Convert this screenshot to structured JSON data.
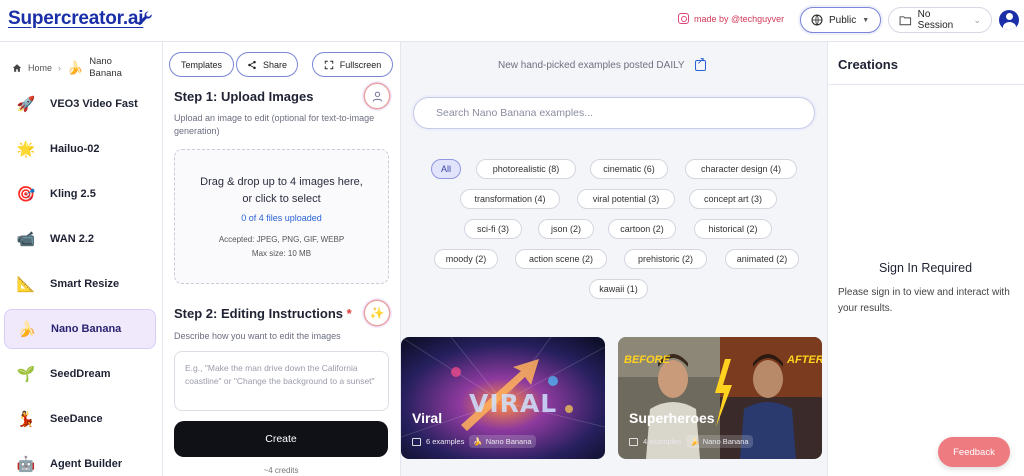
{
  "header": {
    "logo": "Supercreator.ai",
    "made_by": "made by @techguyver",
    "visibility": "Public",
    "session": "No Session"
  },
  "breadcrumb": {
    "home": "Home",
    "current": "Nano Banana"
  },
  "sidebar": {
    "items": [
      {
        "label": "VEO3 Video Fast",
        "icon": "rocket-icon",
        "glyph": "🚀"
      },
      {
        "label": "Hailuo-02",
        "icon": "sparkle-icon",
        "glyph": "🌟"
      },
      {
        "label": "Kling 2.5",
        "icon": "target-icon",
        "glyph": "🎯"
      },
      {
        "label": "WAN 2.2",
        "icon": "camera-icon",
        "glyph": "📹"
      },
      {
        "label": "Smart Resize",
        "icon": "ruler-icon",
        "glyph": "📐"
      },
      {
        "label": "Nano Banana",
        "icon": "banana-icon",
        "glyph": "🍌",
        "active": true
      },
      {
        "label": "SeedDream",
        "icon": "seedling-icon",
        "glyph": "🌱"
      },
      {
        "label": "SeeDance",
        "icon": "dancer-icon",
        "glyph": "💃"
      },
      {
        "label": "Agent Builder",
        "icon": "robot-icon",
        "glyph": "🤖"
      }
    ]
  },
  "toolbar": {
    "templates": "Templates",
    "share": "Share",
    "fullscreen": "Fullscreen"
  },
  "step1": {
    "title": "Step 1: Upload Images",
    "description": "Upload an image to edit (optional for text-to-image generation)",
    "drop_line1": "Drag & drop up to 4 images here,",
    "drop_line2": "or click to select",
    "count": "0 of 4 files uploaded",
    "accepted": "Accepted: JPEG, PNG, GIF, WEBP",
    "max_size": "Max size: 10 MB"
  },
  "step2": {
    "title": "Step 2: Editing Instructions",
    "required_mark": "*",
    "description": "Describe how you want to edit the images",
    "placeholder": "E.g., \"Make the man drive down the California coastline\" or \"Change the background to a sunset\""
  },
  "create": {
    "label": "Create",
    "credits": "~4 credits"
  },
  "examples": {
    "daily_note": "New hand-picked examples posted DAILY",
    "search_placeholder": "Search Nano Banana examples...",
    "filters": [
      "All",
      "photorealistic (8)",
      "cinematic (6)",
      "character design (4)",
      "transformation (4)",
      "viral potential (3)",
      "concept art (3)",
      "sci-fi (3)",
      "json (2)",
      "cartoon (2)",
      "historical (2)",
      "moody (2)",
      "action scene (2)",
      "prehistoric (2)",
      "animated (2)",
      "kawaii (1)"
    ],
    "cards": [
      {
        "name": "Viral",
        "count": "6 examples",
        "tag": "Nano Banana",
        "overlay": "VIRAL"
      },
      {
        "name": "Superheroes",
        "count": "4 examples",
        "tag": "Nano Banana",
        "before": "BEFORE",
        "after": "AFTER"
      }
    ]
  },
  "creations": {
    "title": "Creations",
    "signin_heading": "Sign In Required",
    "signin_text": "Please sign in to view and interact with your results."
  },
  "feedback": "Feedback",
  "colors": {
    "brand": "#1a2ea8",
    "accent": "#7a86d6",
    "feedback": "#ee7b80"
  }
}
